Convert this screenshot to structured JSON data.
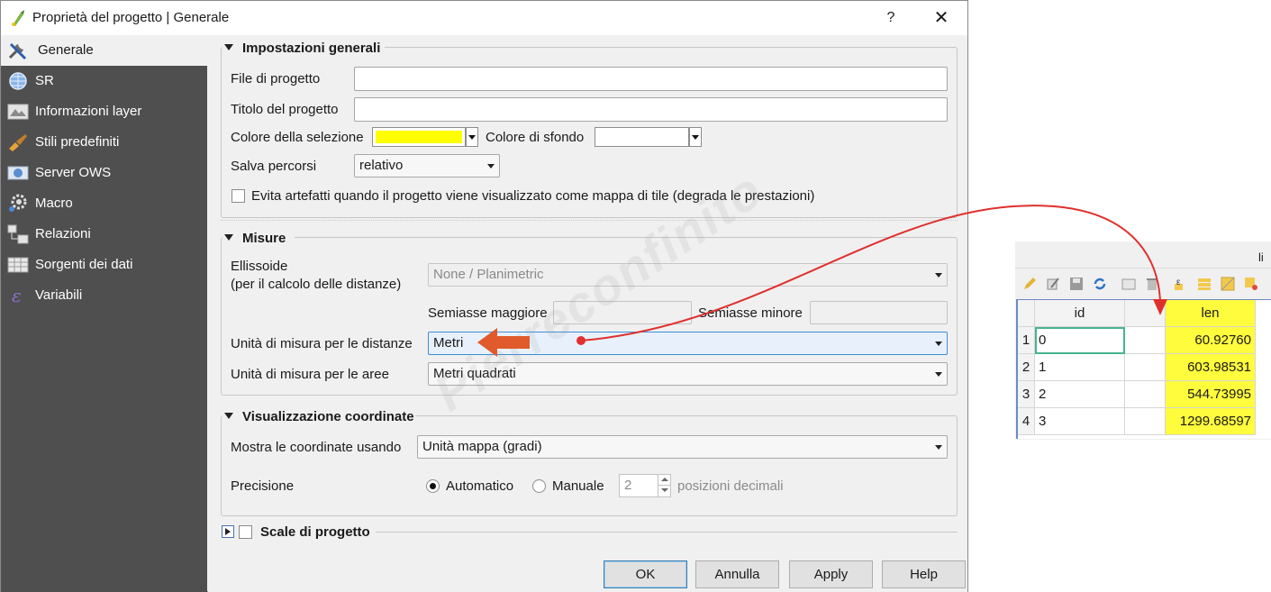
{
  "window": {
    "title": "Proprietà del progetto | Generale",
    "help_label": "?",
    "close_label": "✕"
  },
  "sidebar": {
    "items": [
      {
        "label": "Generale",
        "icon": "tools-icon",
        "active": true
      },
      {
        "label": "SR",
        "icon": "globe-icon"
      },
      {
        "label": "Informazioni layer",
        "icon": "map-info-icon"
      },
      {
        "label": "Stili predefiniti",
        "icon": "brush-icon"
      },
      {
        "label": "Server OWS",
        "icon": "server-ows-icon"
      },
      {
        "label": "Macro",
        "icon": "macro-gear-icon"
      },
      {
        "label": "Relazioni",
        "icon": "relations-icon"
      },
      {
        "label": "Sorgenti dei dati",
        "icon": "table-icon"
      },
      {
        "label": "Variabili",
        "icon": "variable-icon"
      }
    ]
  },
  "general": {
    "heading": "Impostazioni generali",
    "project_file_label": "File di progetto",
    "project_file_value": "",
    "project_title_label": "Titolo del progetto",
    "project_title_value": "",
    "selection_color_label": "Colore della selezione",
    "selection_color": "#ffff00",
    "background_color_label": "Colore di sfondo",
    "background_color": "#ffffff",
    "save_paths_label": "Salva percorsi",
    "save_paths_value": "relativo",
    "avoid_artifacts_label": "Evita artefatti quando il progetto viene visualizzato come mappa di tile (degrada le prestazioni)",
    "avoid_artifacts_checked": false
  },
  "measure": {
    "heading": "Misure",
    "ellipsoid_label_1": "Ellissoide",
    "ellipsoid_label_2": "(per il calcolo  delle distanze)",
    "ellipsoid_value": "None / Planimetric",
    "semimajor_label": "Semiasse maggiore",
    "semiminor_label": "Semiasse minore",
    "distance_units_label": "Unità di misura per le distanze",
    "distance_units_value": "Metri",
    "area_units_label": "Unità di misura per le aree",
    "area_units_value": "Metri quadrati"
  },
  "coords": {
    "heading": "Visualizzazione coordinate",
    "show_using_label": "Mostra le coordinate usando",
    "show_using_value": "Unità mappa (gradi)",
    "precision_label": "Precisione",
    "automatic_label": "Automatico",
    "manual_label": "Manuale",
    "decimals_value": "2",
    "decimals_suffix": "posizioni decimali"
  },
  "scale": {
    "heading": "Scale di progetto"
  },
  "buttons": {
    "ok": "OK",
    "cancel": "Annulla",
    "apply": "Apply",
    "help": "Help"
  },
  "watermark": "Pierreconfinito",
  "attribute_table": {
    "title_fragment": "li",
    "headers": [
      "id",
      "",
      "len"
    ],
    "rows": [
      {
        "n": "1",
        "id": "0",
        "len": "60.92760"
      },
      {
        "n": "2",
        "id": "1",
        "len": "603.98531"
      },
      {
        "n": "3",
        "id": "2",
        "len": "544.73995"
      },
      {
        "n": "4",
        "id": "3",
        "len": "1299.68597"
      }
    ],
    "highlight_color": "#fffb3d"
  },
  "annotation": {
    "arrow_color": "#e05a2b",
    "connector_color": "#e0302e"
  }
}
